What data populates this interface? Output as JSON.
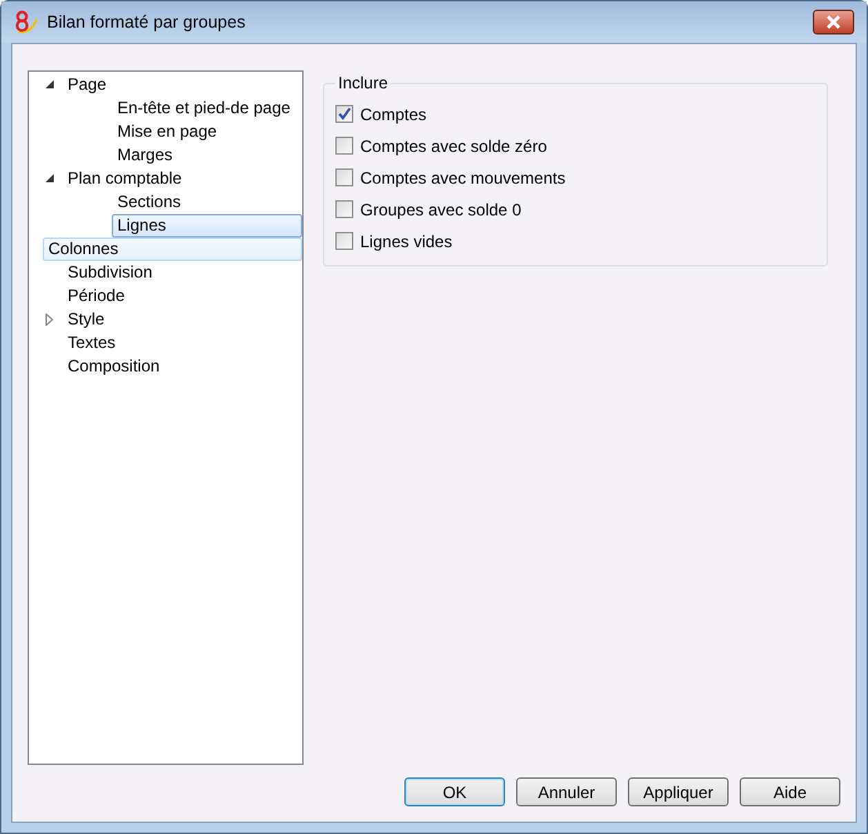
{
  "window": {
    "title": "Bilan formaté par groupes"
  },
  "tree": [
    {
      "label": "Page",
      "expanded": true,
      "selected": false,
      "hovered": false,
      "children": [
        {
          "label": "En-tête et pied-de page",
          "selected": false,
          "hovered": false
        },
        {
          "label": "Mise en page",
          "selected": false,
          "hovered": false
        },
        {
          "label": "Marges",
          "selected": false,
          "hovered": false
        }
      ]
    },
    {
      "label": "Plan comptable",
      "expanded": true,
      "selected": false,
      "hovered": false,
      "children": [
        {
          "label": "Sections",
          "selected": false,
          "hovered": false
        },
        {
          "label": "Lignes",
          "selected": true,
          "hovered": false
        }
      ]
    },
    {
      "label": "Colonnes",
      "selected": false,
      "hovered": true
    },
    {
      "label": "Subdivision",
      "selected": false,
      "hovered": false
    },
    {
      "label": "Période",
      "selected": false,
      "hovered": false
    },
    {
      "label": "Style",
      "expanded": false,
      "selected": false,
      "hovered": false
    },
    {
      "label": "Textes",
      "selected": false,
      "hovered": false
    },
    {
      "label": "Composition",
      "selected": false,
      "hovered": false
    }
  ],
  "group": {
    "title": "Inclure",
    "options": [
      {
        "label": "Comptes",
        "checked": true
      },
      {
        "label": "Comptes avec solde zéro",
        "checked": false
      },
      {
        "label": "Comptes avec mouvements",
        "checked": false
      },
      {
        "label": "Groupes avec solde 0",
        "checked": false
      },
      {
        "label": "Lignes vides",
        "checked": false
      }
    ]
  },
  "buttons": [
    {
      "label": "OK",
      "default": true
    },
    {
      "label": "Annuler",
      "default": false
    },
    {
      "label": "Appliquer",
      "default": false
    },
    {
      "label": "Aide",
      "default": false
    }
  ]
}
